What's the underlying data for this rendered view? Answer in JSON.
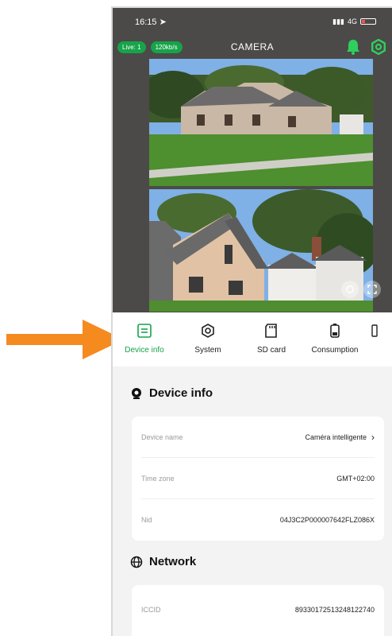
{
  "status_bar": {
    "time": "16:15",
    "network": "4G"
  },
  "camera": {
    "title": "CAMERA",
    "live_badge": "Live: 1",
    "speed_badge": "120kb/s"
  },
  "tabs": [
    {
      "label": "Device info",
      "active": true
    },
    {
      "label": "System",
      "active": false
    },
    {
      "label": "SD card",
      "active": false
    },
    {
      "label": "Consumption",
      "active": false
    }
  ],
  "device_info": {
    "title": "Device info",
    "rows": [
      {
        "label": "Device name",
        "value": "Caméra intelligente"
      },
      {
        "label": "Time zone",
        "value": "GMT+02:00"
      },
      {
        "label": "Nid",
        "value": "04J3C2P000007642FLZ086X"
      }
    ]
  },
  "network": {
    "title": "Network",
    "rows": [
      {
        "label": "ICCID",
        "value": "89330172513248122740"
      }
    ]
  },
  "colors": {
    "accent": "#17a34a",
    "arrow": "#f58a1f",
    "camera_bg": "#4b4a48"
  }
}
